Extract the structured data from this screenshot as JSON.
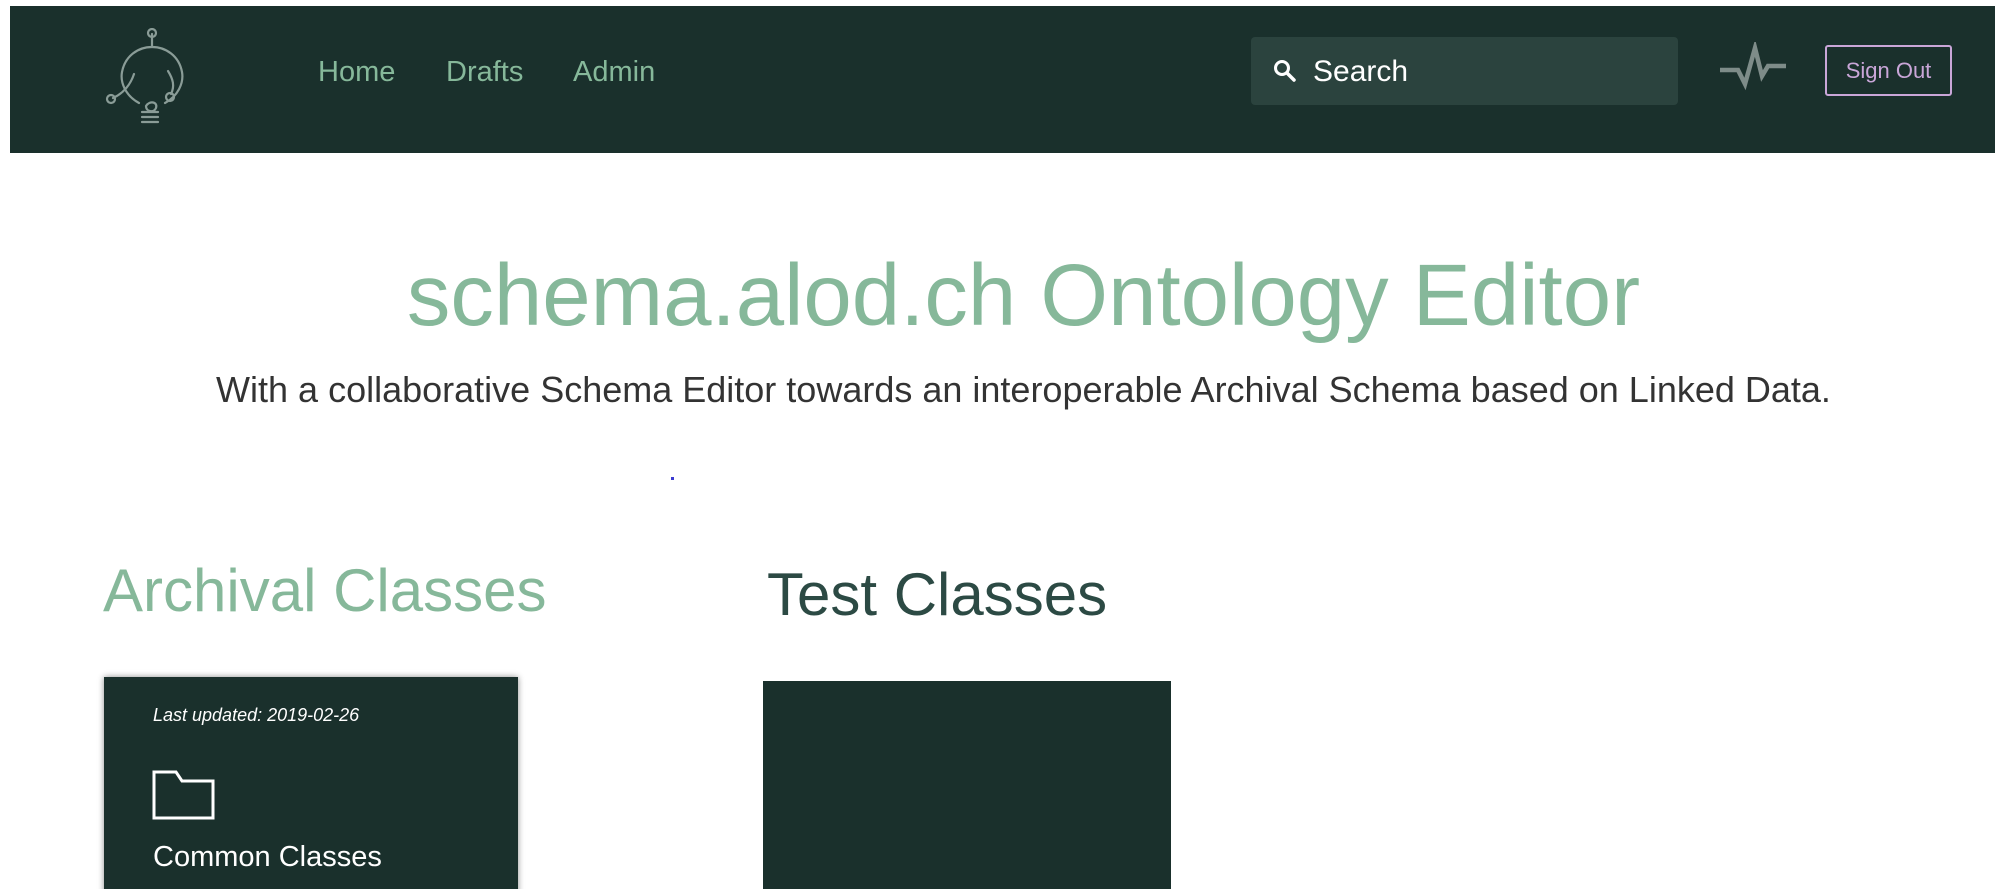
{
  "nav": {
    "links": [
      {
        "label": "Home"
      },
      {
        "label": "Drafts"
      },
      {
        "label": "Admin"
      }
    ],
    "search_placeholder": "Search",
    "signout_label": "Sign Out"
  },
  "hero": {
    "title": "schema.alod.ch Ontology Editor",
    "subtitle": "With a collaborative Schema Editor towards an interoperable Archival Schema based on Linked Data."
  },
  "sections": {
    "archival": {
      "title": "Archival Classes",
      "card": {
        "updated": "Last updated: 2019-02-26",
        "name": "Common Classes",
        "icon": "folder-icon"
      }
    },
    "test": {
      "title": "Test Classes"
    }
  },
  "colors": {
    "navbar_bg": "#1a302c",
    "accent_green": "#86b89a",
    "signout_purple": "#c9a6d8",
    "card_bg": "#1a302c"
  },
  "icons": {
    "logo": "lightbulb-logo-icon",
    "search": "search-icon",
    "activity": "pulse-icon"
  }
}
